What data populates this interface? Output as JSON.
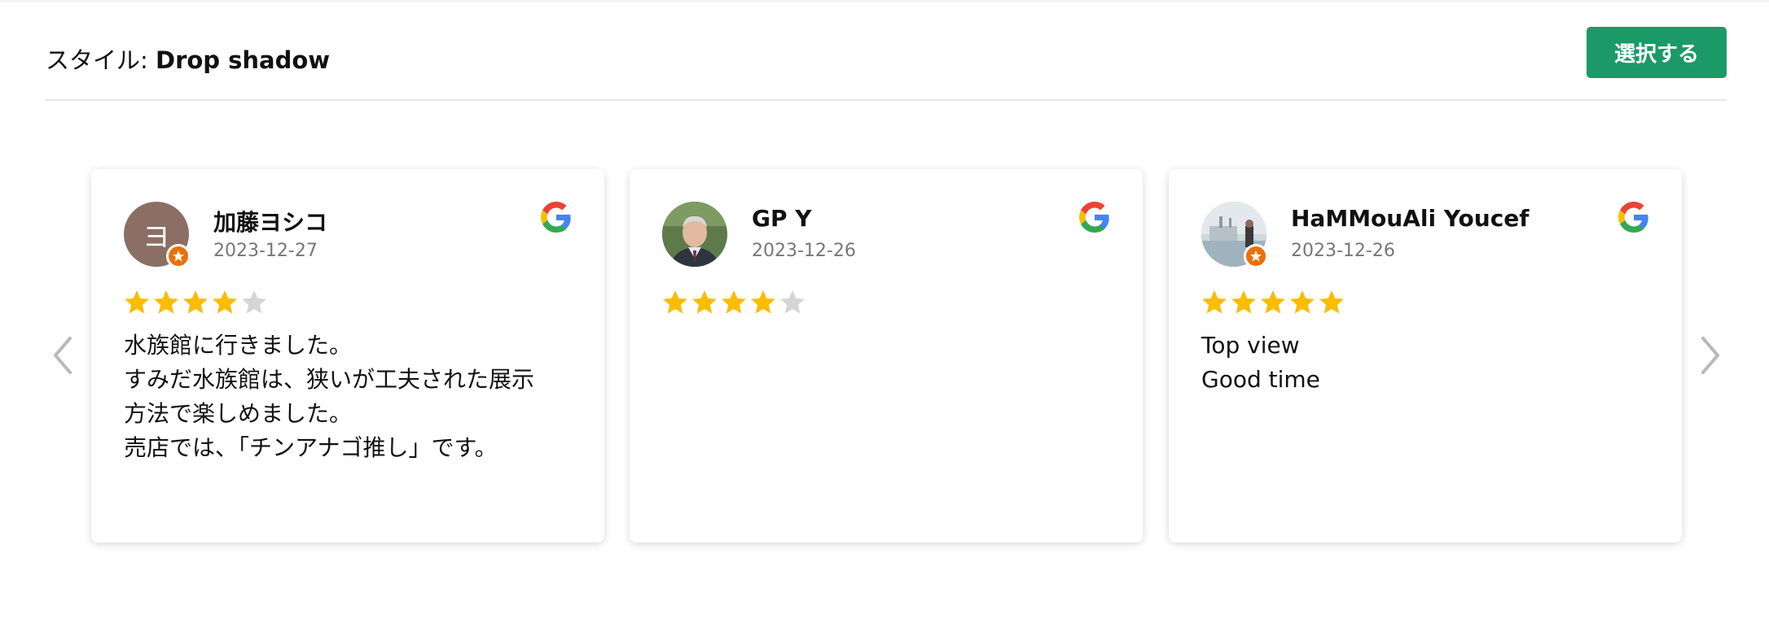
{
  "header": {
    "style_prefix": "スタイル: ",
    "style_name": "Drop shadow",
    "select_label": "選択する"
  },
  "colors": {
    "button": "#1b9a68",
    "star_filled": "#fbbc04",
    "star_empty": "#d5d5d5",
    "badge": "#e8710a"
  },
  "navigation": {
    "prev_icon": "chevron-left-icon",
    "next_icon": "chevron-right-icon"
  },
  "reviews": [
    {
      "author": "加藤ヨシコ",
      "date": "2023-12-27",
      "avatar_letter": "ヨ",
      "rating": 4,
      "source_icon": "google-icon",
      "lines": [
        "水族館に行きました。",
        "すみだ水族館は、狭いが工夫された展示",
        "方法で楽しめました。",
        "売店では、「チンアナゴ推し」です。"
      ]
    },
    {
      "author": "GP Y",
      "date": "2023-12-26",
      "rating": 4,
      "source_icon": "google-icon",
      "lines": []
    },
    {
      "author": "HaMMouAli Youcef",
      "date": "2023-12-26",
      "rating": 5,
      "source_icon": "google-icon",
      "lines": [
        "Top view",
        "Good time"
      ]
    }
  ]
}
